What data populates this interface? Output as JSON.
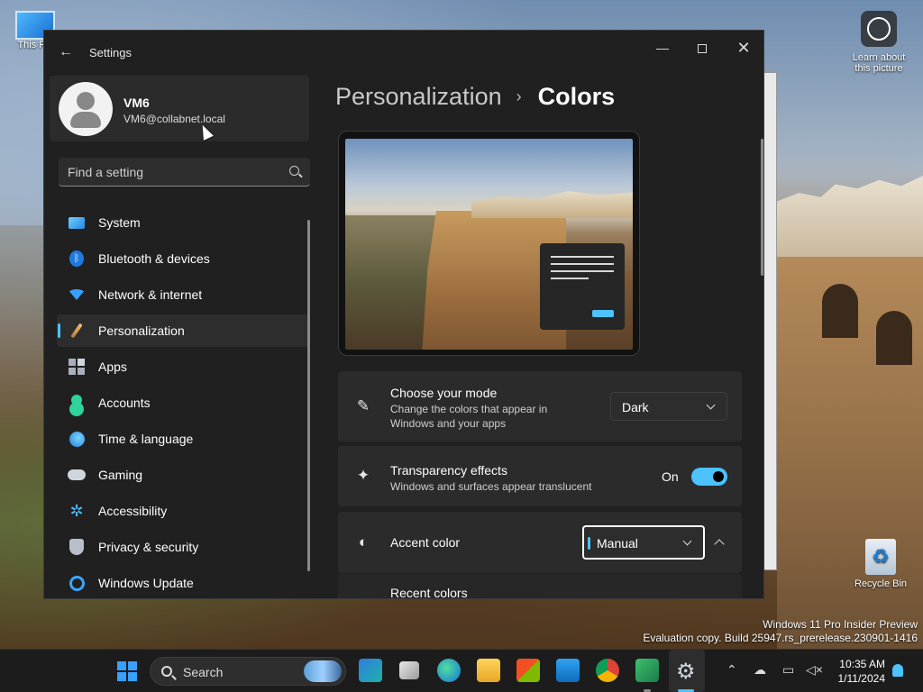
{
  "desktop": {
    "icons": {
      "this_pc": "This PC",
      "learn": "Learn about this picture",
      "recycle_bin": "Recycle Bin"
    },
    "watermark": {
      "line1": "Windows 11 Pro Insider Preview",
      "line2": "Evaluation copy. Build 25947.rs_prerelease.230901-1416"
    }
  },
  "window": {
    "title": "Settings",
    "back_icon": "back-arrow-icon",
    "controls": [
      "minimize",
      "maximize",
      "close"
    ]
  },
  "user": {
    "name": "VM6",
    "email": "VM6@collabnet.local"
  },
  "search": {
    "placeholder": "Find a setting",
    "value": ""
  },
  "sidebar": {
    "items": [
      {
        "label": "System",
        "icon": "system-icon"
      },
      {
        "label": "Bluetooth & devices",
        "icon": "bluetooth-icon"
      },
      {
        "label": "Network & internet",
        "icon": "wifi-icon"
      },
      {
        "label": "Personalization",
        "icon": "brush-icon",
        "active": true
      },
      {
        "label": "Apps",
        "icon": "apps-icon"
      },
      {
        "label": "Accounts",
        "icon": "person-icon"
      },
      {
        "label": "Time & language",
        "icon": "globe-clock-icon"
      },
      {
        "label": "Gaming",
        "icon": "gamepad-icon"
      },
      {
        "label": "Accessibility",
        "icon": "accessibility-icon"
      },
      {
        "label": "Privacy & security",
        "icon": "shield-icon"
      },
      {
        "label": "Windows Update",
        "icon": "update-icon"
      }
    ]
  },
  "main": {
    "breadcrumb": {
      "parent": "Personalization",
      "separator": "›",
      "current": "Colors"
    },
    "mode": {
      "title": "Choose your mode",
      "description": "Change the colors that appear in Windows and your apps",
      "value": "Dark",
      "icon": "brush-icon"
    },
    "transparency": {
      "title": "Transparency effects",
      "description": "Windows and surfaces appear translucent",
      "state_label": "On",
      "on": true,
      "icon": "sparkle-icon"
    },
    "accent": {
      "title": "Accent color",
      "value": "Manual",
      "expanded": true,
      "icon": "palette-icon"
    },
    "recent_colors": {
      "title": "Recent colors"
    }
  },
  "taskbar": {
    "search_label": "Search",
    "apps": [
      "edge-dev-icon",
      "task-view-icon",
      "edge-icon",
      "file-explorer-icon",
      "store-icon",
      "mail-icon",
      "chrome-icon",
      "app-icon",
      "settings-icon"
    ],
    "tray": [
      "chevron-up-icon",
      "cloud-icon",
      "network-icon",
      "volume-muted-icon"
    ],
    "time": "10:35 AM",
    "date": "1/11/2024"
  },
  "colors": {
    "accent": "#4cc2ff",
    "window_bg": "#202020",
    "card_bg": "#2b2b2b"
  }
}
